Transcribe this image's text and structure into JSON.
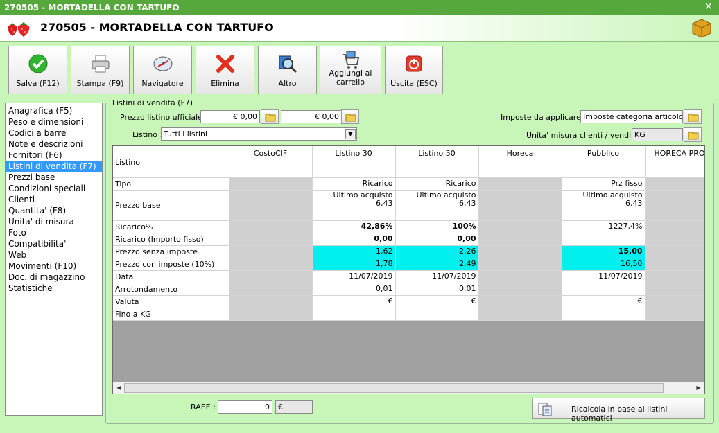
{
  "window": {
    "title": "270505 - MORTADELLA CON TARTUFO",
    "close": "×"
  },
  "header": {
    "title": "270505 - MORTADELLA CON TARTUFO"
  },
  "toolbar": {
    "save": "Salva (F12)",
    "print": "Stampa (F9)",
    "navigator": "Navigatore",
    "delete": "Elimina",
    "other": "Altro",
    "cart_line1": "Aggiungi al",
    "cart_line2": "carrello",
    "exit": "Uscita (ESC)"
  },
  "nav": {
    "items": [
      "Anagrafica (F5)",
      "Peso e dimensioni",
      "Codici a barre",
      "Note e descrizioni",
      "Fornitori (F6)",
      "Listini di vendita (F7)",
      "Prezzi base",
      "Condizioni speciali",
      "Clienti",
      "Quantita' (F8)",
      "Unita' di misura",
      "Foto",
      "Compatibilita'",
      "Web",
      "Movimenti (F10)",
      "Doc. di magazzino",
      "Statistiche"
    ],
    "selected_index": 5
  },
  "section": {
    "title": "Listini di vendita (F7)",
    "official_price_label": "Prezzo listino ufficiale :",
    "official_price_1": "€ 0,00",
    "official_price_2": "€ 0,00",
    "list_label": "Listino :",
    "list_value": "Tutti i listini",
    "taxes_label": "Imposte da applicare :",
    "taxes_value": "Imposte categoria articolo",
    "unit_label": "Unita' misura clienti / vendita :",
    "unit_value": "KG"
  },
  "grid": {
    "row_header": "Listino",
    "columns": [
      "CostoCIF",
      "Listino 30",
      "Listino 50",
      "Horeca",
      "Pubblico",
      "HORECA PRO"
    ],
    "rows": [
      {
        "label": "Tipo",
        "cells": [
          "",
          "Ricarico",
          "Ricarico",
          "",
          "Prz fisso",
          ""
        ]
      },
      {
        "label": "Prezzo base",
        "cells": [
          "",
          "Ultimo acquisto",
          "Ultimo acquisto",
          "",
          "Ultimo acquisto",
          ""
        ],
        "cells2": [
          "",
          "6,43",
          "6,43",
          "",
          "6,43",
          ""
        ]
      },
      {
        "label": "Ricarico%",
        "cells": [
          "",
          "42,86%",
          "100%",
          "",
          "1227,4%",
          ""
        ]
      },
      {
        "label": "Ricarico (Importo fisso)",
        "cells": [
          "",
          "0,00",
          "0,00",
          "",
          "",
          ""
        ]
      },
      {
        "label": "Prezzo senza imposte",
        "cells": [
          "",
          "1,62",
          "2,26",
          "",
          "15,00",
          ""
        ]
      },
      {
        "label": "Prezzo con imposte (10%)",
        "cells": [
          "",
          "1,78",
          "2,49",
          "",
          "16,50",
          ""
        ]
      },
      {
        "label": "Data",
        "cells": [
          "",
          "11/07/2019",
          "11/07/2019",
          "",
          "11/07/2019",
          ""
        ]
      },
      {
        "label": "Arrotondamento",
        "cells": [
          "",
          "0,01",
          "0,01",
          "",
          "",
          ""
        ]
      },
      {
        "label": "Valuta",
        "cells": [
          "",
          "€",
          "€",
          "",
          "€",
          ""
        ]
      },
      {
        "label": "Fino a KG",
        "cells": [
          "",
          "",
          "",
          "",
          "",
          ""
        ]
      }
    ]
  },
  "footer": {
    "raee_label": "RAEE :",
    "raee_value": "0",
    "raee_currency": "€",
    "recalc_button": "Ricalcola in base ai listini automatici"
  },
  "colors": {
    "window_bg": "#c8f5b8",
    "title_bar": "#56a83c",
    "selection": "#3399ff",
    "highlight_cell": "#00f0f0",
    "disabled_cell": "#d0d0d0"
  }
}
